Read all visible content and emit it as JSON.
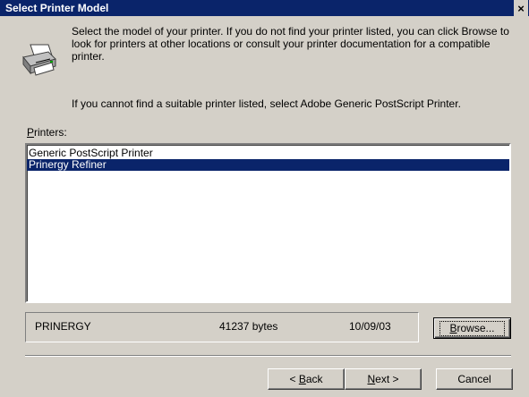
{
  "window": {
    "title": "Select Printer Model",
    "close_glyph": "×",
    "icon": "printer-icon"
  },
  "intro": {
    "line1": "Select the model of your printer. If you do not find your printer listed, you can click Browse to look for printers at other locations or consult your printer documentation for a compatible printer.",
    "line2": "If you cannot find a suitable printer listed, select Adobe Generic PostScript Printer."
  },
  "printers": {
    "label_mnemonic": "P",
    "label_rest": "rinters:",
    "items": [
      {
        "label": "Generic PostScript Printer",
        "selected": false
      },
      {
        "label": "Prinergy Refiner",
        "selected": true
      }
    ]
  },
  "file_info": {
    "name": "PRINERGY",
    "size": "41237 bytes",
    "date": "10/09/03"
  },
  "buttons": {
    "browse_mnemonic": "B",
    "browse_rest": "rowse...",
    "back_prefix": "< ",
    "back_mnemonic": "B",
    "back_rest": "ack",
    "next_mnemonic": "N",
    "next_rest": "ext >",
    "cancel": "Cancel"
  },
  "colors": {
    "titlebar": "#0a246a",
    "selection": "#0a246a",
    "face": "#d4d0c8"
  }
}
